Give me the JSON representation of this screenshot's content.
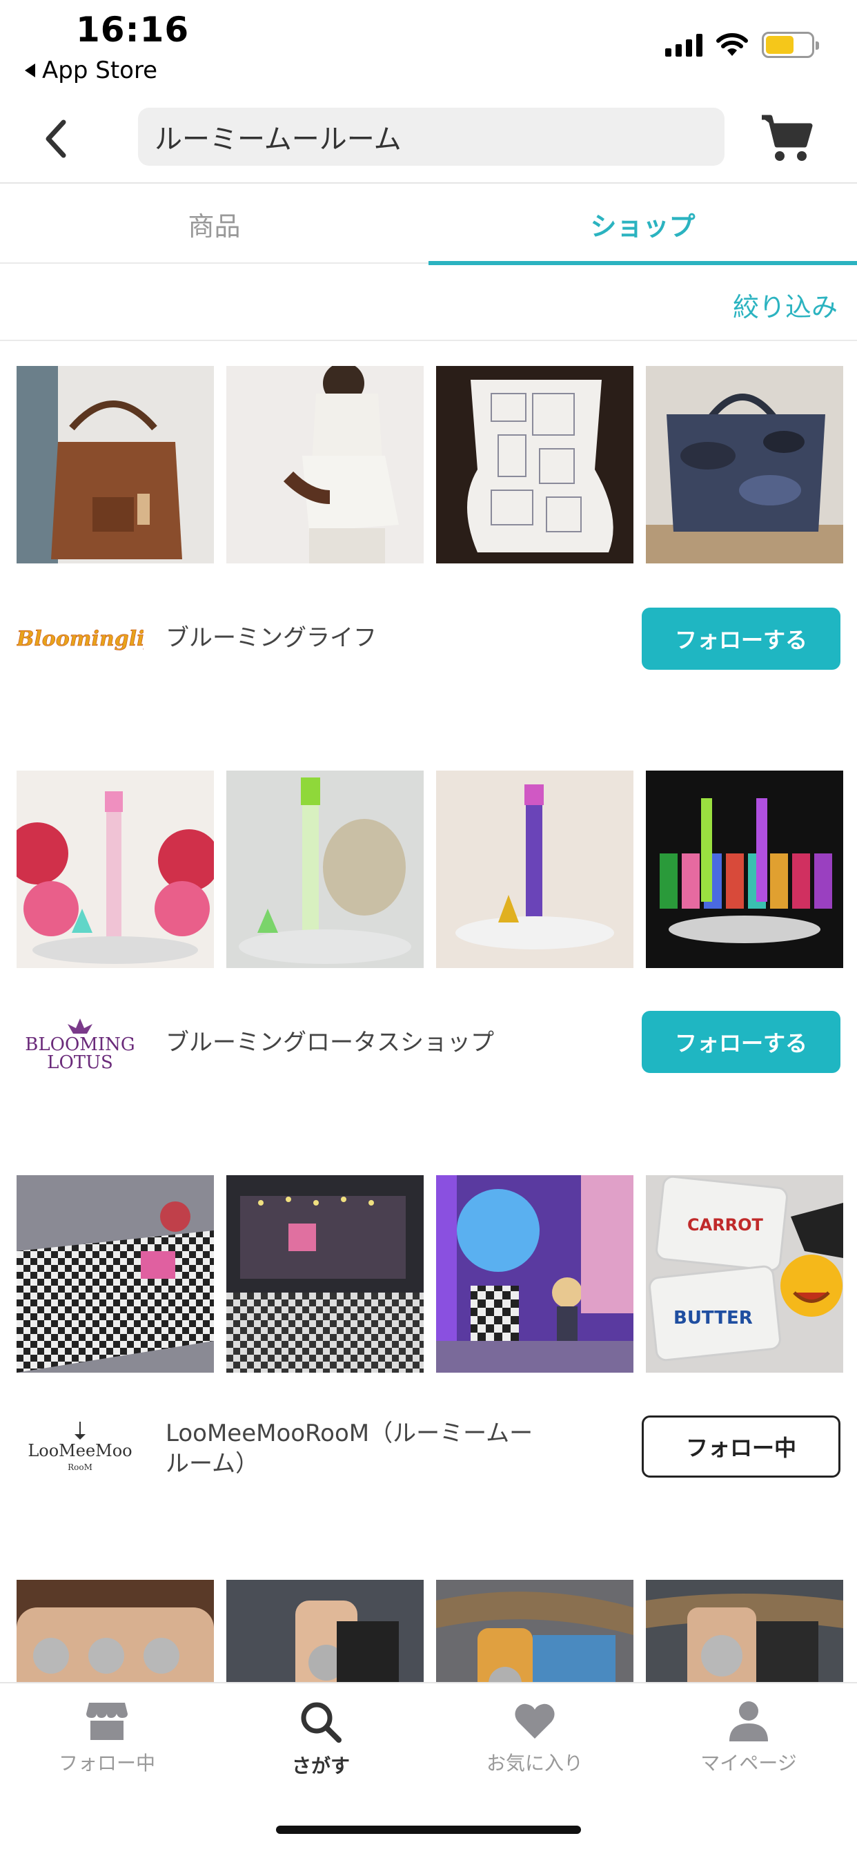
{
  "status_bar": {
    "time": "16:16",
    "back_app": "App Store",
    "battery_color": "#f5c71a"
  },
  "header": {
    "search_value": "ルーミームールーム",
    "back_icon": "chevron-left-icon",
    "cart_icon": "cart-icon"
  },
  "tabs": [
    {
      "label": "商品",
      "active": false
    },
    {
      "label": "ショップ",
      "active": true
    }
  ],
  "filter_label": "絞り込み",
  "accent_color": "#2bb3c0",
  "shops": [
    {
      "name": "ブルーミングライフ",
      "logo_text": "Bloominglife",
      "button": "フォローする",
      "following": false
    },
    {
      "name": "ブルーミングロータスショップ",
      "logo_text_1": "BLOOMING",
      "logo_text_2": "LOTUS",
      "button": "フォローする",
      "following": false
    },
    {
      "name": "LooMeeMooRooM（ルーミームールーム）",
      "logo_text_1": "LooMeeMoo",
      "logo_text_2": "RooM",
      "button": "フォロー中",
      "following": true
    }
  ],
  "thumb_text": {
    "carrot": "CARROT",
    "butter": "BUTTER"
  },
  "bottom_nav": [
    {
      "label": "フォロー中",
      "icon": "store-icon",
      "active": false
    },
    {
      "label": "さがす",
      "icon": "search-icon",
      "active": true
    },
    {
      "label": "お気に入り",
      "icon": "heart-icon",
      "active": false
    },
    {
      "label": "マイページ",
      "icon": "person-icon",
      "active": false
    }
  ]
}
